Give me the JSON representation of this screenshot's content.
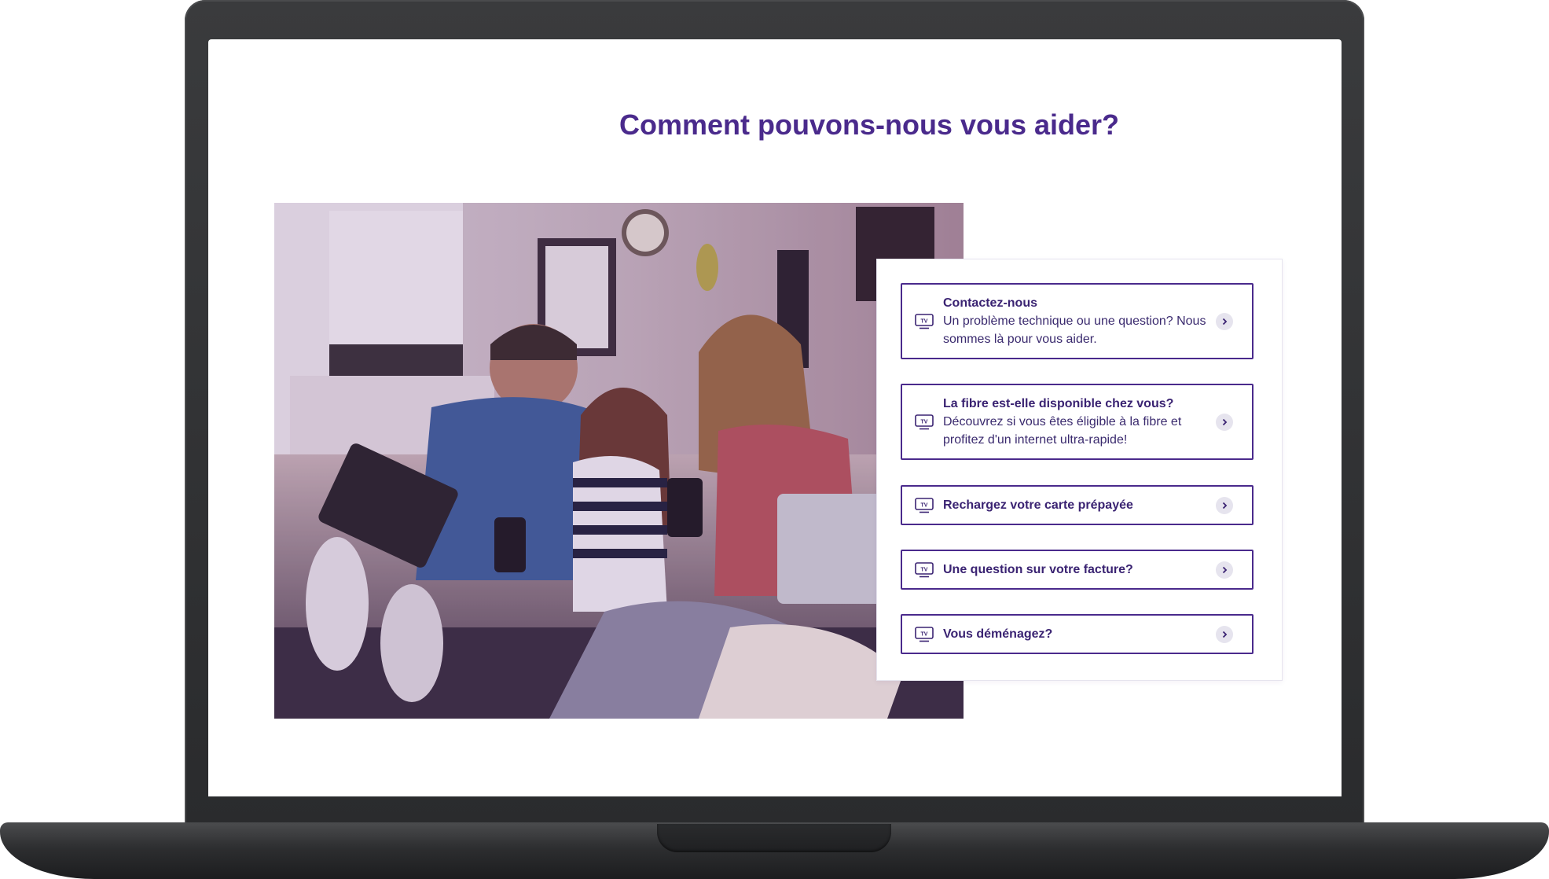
{
  "page": {
    "heading": "Comment pouvons-nous vous aider?"
  },
  "colors": {
    "brand_purple": "#4a2a8c",
    "card_border": "#4a2a8c",
    "arrow_bg": "#e6e4ee"
  },
  "help_cards": [
    {
      "title": "Contactez-nous",
      "description": "Un problème technique ou une question? Nous sommes là pour vous aider.",
      "icon": "tv-icon"
    },
    {
      "title": "La fibre est-elle disponible chez vous?",
      "description": "Découvrez si vous êtes éligible à la fibre et profitez d'un internet ultra-rapide!",
      "icon": "tv-icon"
    },
    {
      "title": "Rechargez votre carte prépayée",
      "description": "",
      "icon": "tv-icon"
    },
    {
      "title": "Une question sur votre facture?",
      "description": "",
      "icon": "tv-icon"
    },
    {
      "title": "Vous déménagez?",
      "description": "",
      "icon": "tv-icon"
    }
  ]
}
